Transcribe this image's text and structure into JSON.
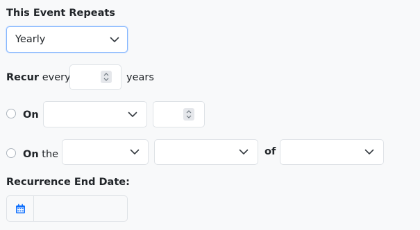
{
  "repeat": {
    "label": "This Event Repeats",
    "value": "Yearly"
  },
  "recur": {
    "label_bold": "Recur",
    "label_rest": "every",
    "value": "",
    "unit": "years"
  },
  "on": {
    "label": "On",
    "month": "",
    "day": ""
  },
  "on_the": {
    "label_bold": "On",
    "label_rest": "the",
    "ordinal": "",
    "weekday": "",
    "of_label": "of",
    "month": ""
  },
  "end_date": {
    "label": "Recurrence End Date:",
    "value": "",
    "icon": "calendar-icon"
  },
  "colors": {
    "accent": "#0d6efd",
    "focus_border": "#86b7fe"
  }
}
